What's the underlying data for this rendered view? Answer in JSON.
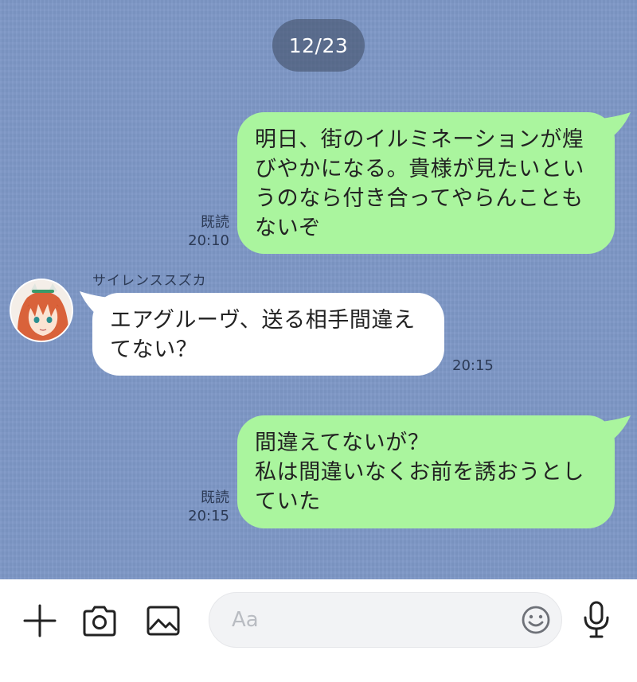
{
  "date_separator": "12/23",
  "messages": [
    {
      "direction": "outgoing",
      "lines": [
        "明日、街のイルミネーションが煌",
        "びやかになる。貴様が見たいとい",
        "うのなら付き合ってやらんことも",
        "ないぞ"
      ],
      "read_label": "既読",
      "time": "20:10"
    },
    {
      "direction": "incoming",
      "sender": "サイレンススズカ",
      "lines": [
        "エアグルーヴ、送る相手間違え",
        "てない？"
      ],
      "time": "20:15"
    },
    {
      "direction": "outgoing",
      "lines": [
        "間違えてないが？",
        "私は間違いなくお前を誘おうとし",
        "ていた"
      ],
      "read_label": "既読",
      "time": "20:15"
    }
  ],
  "input": {
    "placeholder": "Aa"
  },
  "icons": [
    "plus-icon",
    "camera-icon",
    "image-icon",
    "emoji-icon",
    "microphone-icon"
  ],
  "colors": {
    "chat_background": "#7d97c6",
    "outgoing_bubble": "#aaf59e",
    "incoming_bubble": "#ffffff"
  }
}
